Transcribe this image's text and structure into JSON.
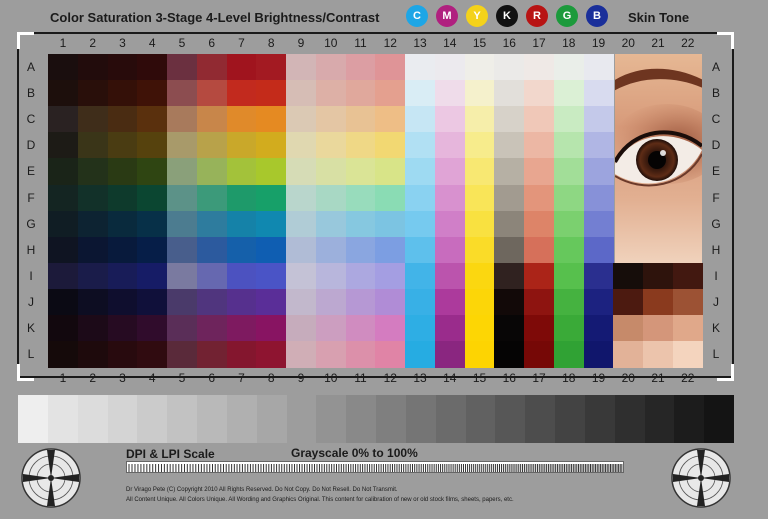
{
  "title": "Color Saturation 3-Stage 4-Level Brightness/Contrast",
  "skin_title": "Skin Tone",
  "ink_dots": [
    {
      "label": "C",
      "color": "#1ea6e6"
    },
    {
      "label": "M",
      "color": "#b0207f"
    },
    {
      "label": "Y",
      "color": "#f4d21a"
    },
    {
      "label": "K",
      "color": "#111111"
    },
    {
      "label": "R",
      "color": "#b81414"
    },
    {
      "label": "G",
      "color": "#1c9a3c"
    },
    {
      "label": "B",
      "color": "#1a2f9a"
    }
  ],
  "columns": [
    "1",
    "2",
    "3",
    "4",
    "5",
    "6",
    "7",
    "8",
    "9",
    "10",
    "11",
    "12",
    "13",
    "14",
    "15",
    "16",
    "17",
    "18",
    "19",
    "20",
    "21",
    "22"
  ],
  "rows": [
    "A",
    "B",
    "C",
    "D",
    "E",
    "F",
    "G",
    "H",
    "I",
    "J",
    "K",
    "L"
  ],
  "patch_colors": [
    [
      "#1a0e0e",
      "#220c0c",
      "#280b0b",
      "#2f0a0a",
      "#6b3040",
      "#912a32",
      "#a0141e",
      "#a31a22",
      "#d2b5b6",
      "#d8aaac",
      "#dc9ea3",
      "#df9497",
      "#eaecf0",
      "#eceaee",
      "#efeee8",
      "#ebeae8",
      "#efe9e6",
      "#eaeee9",
      "#e8e9ef"
    ],
    [
      "#1d0f0c",
      "#290f0a",
      "#341008",
      "#3f1207",
      "#8c4d50",
      "#b54a40",
      "#c22a1e",
      "#c42b1a",
      "#d6bdb5",
      "#ddb0a6",
      "#e0a89c",
      "#e4a08f",
      "#d9edf5",
      "#efdcea",
      "#f5f1cc",
      "#e2dfda",
      "#f2d7cc",
      "#dbf0d5",
      "#d8dbef"
    ],
    [
      "#2a2222",
      "#3f2d1a",
      "#4a2c12",
      "#5a300d",
      "#a87a5c",
      "#c8864a",
      "#e08a2a",
      "#e58a22",
      "#dbc9b4",
      "#e4c6a4",
      "#e8c294",
      "#eebe86",
      "#c6e6f4",
      "#ecc8e3",
      "#f6eeaa",
      "#d7d2c9",
      "#f0c8b8",
      "#c9ebc2",
      "#c4c9ea"
    ],
    [
      "#1d1b16",
      "#3a3518",
      "#4a3c12",
      "#56420d",
      "#a89a6a",
      "#b8a24a",
      "#c9a82a",
      "#d2ac1e",
      "#e0d8b0",
      "#ead89c",
      "#efd886",
      "#f2d872",
      "#b1e0f3",
      "#e6b6dc",
      "#f7ec8c",
      "#c9c3b8",
      "#ecb7a4",
      "#b6e5ad",
      "#b0b6e4"
    ],
    [
      "#1a2418",
      "#23321a",
      "#2a3a14",
      "#2f4512",
      "#8aa07a",
      "#97b35a",
      "#a3c23a",
      "#a8c82c",
      "#d6dcb6",
      "#d8e0a4",
      "#dae496",
      "#d8e488",
      "#9edaf2",
      "#e0a4d6",
      "#f8e872",
      "#b6b0a4",
      "#e8a690",
      "#a2de98",
      "#9ca4de"
    ],
    [
      "#142522",
      "#123129",
      "#0e3a2c",
      "#0b4631",
      "#5c9288",
      "#3c9a7a",
      "#1e9a6a",
      "#17a069",
      "#b9d6cc",
      "#a8d8c4",
      "#98dcbc",
      "#8adcb4",
      "#8ad2f1",
      "#d891cf",
      "#f9e558",
      "#a29b90",
      "#e3957b",
      "#8ed783",
      "#8791d8"
    ],
    [
      "#101d24",
      "#0d2332",
      "#092a3d",
      "#073048",
      "#4c7c90",
      "#2e7c9e",
      "#1582a8",
      "#1088b0",
      "#b0ccd6",
      "#98c8dc",
      "#86c8e0",
      "#7cc4e2",
      "#76caef",
      "#d07fc8",
      "#f9e140",
      "#8c857a",
      "#dd8468",
      "#7bd06f",
      "#737fd2"
    ],
    [
      "#0f1422",
      "#0b1632",
      "#081a3c",
      "#061e48",
      "#485e8c",
      "#2c5a9e",
      "#1560aa",
      "#0f5eb2",
      "#b0bcd6",
      "#9cb0dc",
      "#8aa6e0",
      "#7c9ee2",
      "#5ec0ec",
      "#c86cbe",
      "#fadc28",
      "#6e675e",
      "#d6705a",
      "#66c85c",
      "#5c68c8"
    ],
    [
      "#1c1a3a",
      "#1a1c4a",
      "#181c58",
      "#161c66",
      "#7a7aa0",
      "#6668b0",
      "#4c52c0",
      "#4a54c6",
      "#c4c2d6",
      "#b8b6dc",
      "#aca8e0",
      "#a49ee2",
      "#42b4e8",
      "#bb54ad",
      "#fbd710",
      "#302220",
      "#ab2418",
      "#57c04d",
      "#2a2f8f"
    ],
    [
      "#0b0a14",
      "#0d0d22",
      "#0f0e2e",
      "#10103a",
      "#4a3a6a",
      "#50357e",
      "#56308e",
      "#5a2e98",
      "#c2b8cc",
      "#bca8d0",
      "#b698d4",
      "#b08cd6",
      "#38b0e6",
      "#ac3a9c",
      "#fcd608",
      "#120908",
      "#8e1410",
      "#45b240",
      "#1c2280"
    ],
    [
      "#12080e",
      "#1c0a18",
      "#260b22",
      "#300c2c",
      "#5a2e58",
      "#6e245c",
      "#7e1a60",
      "#881462",
      "#c6acbc",
      "#cc9ec0",
      "#d08cc0",
      "#d47cc0",
      "#2eaee4",
      "#9a2c8c",
      "#fdd604",
      "#080606",
      "#7e0a08",
      "#3aaa38",
      "#141a74"
    ],
    [
      "#150a0a",
      "#1e0a0c",
      "#280a0e",
      "#300b10",
      "#5a2a3a",
      "#722232",
      "#84162e",
      "#8e1430",
      "#d0aeb6",
      "#d8a0b0",
      "#dc90aa",
      "#e084a6",
      "#26ace2",
      "#8a2680",
      "#fdd402",
      "#050404",
      "#760806",
      "#30a234",
      "#10166c"
    ]
  ],
  "skin_patch_colors": [
    [
      "#160d0a",
      "#2e130c",
      "#421810"
    ],
    [
      "#4c1a10",
      "#8a3a1e",
      "#9c5234"
    ],
    [
      "#c68a6a",
      "#d4967a",
      "#e0a88a"
    ],
    [
      "#e2b298",
      "#ecc4ac",
      "#f4d4be"
    ]
  ],
  "grayscale_colors": [
    "#eeeeee",
    "#e3e3e3",
    "#dcdcdc",
    "#d4d4d4",
    "#cbcbcb",
    "#c2c2c2",
    "#b9b9b9",
    "#b0b0b0",
    "#a7a7a7",
    "#9d9d9d",
    "#939393",
    "#898989",
    "#7f7f7f",
    "#757575",
    "#6b6b6b",
    "#616161",
    "#575757",
    "#4d4d4d",
    "#434343",
    "#393939",
    "#2f2f2f",
    "#262626",
    "#1c1c1c",
    "#141414"
  ],
  "dpi_title": "DPI & LPI Scale",
  "grayscale_title": "Grayscale 0% to 100%",
  "copyright_line1": "Dr Virago Pete (C) Copyright 2010 All Rights Reserved. Do Not Copy. Do Not Resell. Do Not Transmit.",
  "copyright_line2": "All Content Unique. All Colors Unique. All Wording and Graphics Original. This content for calibration of new or old stock films, sheets, papers, etc."
}
